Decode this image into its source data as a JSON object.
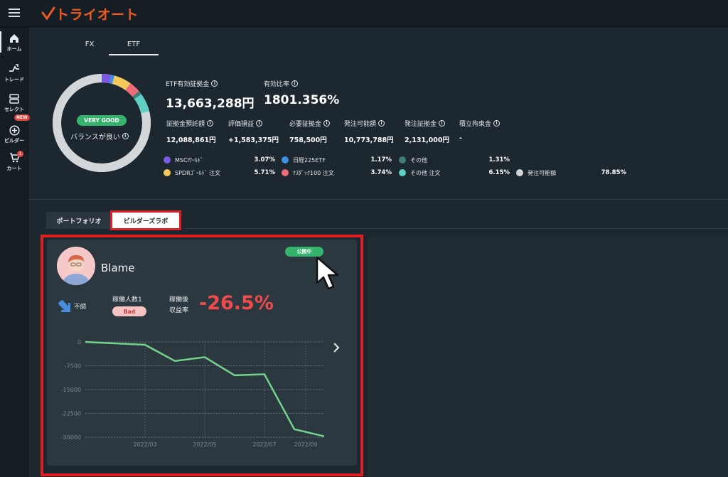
{
  "app": {
    "logo": "トライオート"
  },
  "sidebar": {
    "items": [
      {
        "label": "ホーム",
        "icon": "home-icon"
      },
      {
        "label": "トレード",
        "icon": "trade-icon"
      },
      {
        "label": "セレクト",
        "icon": "select-icon"
      },
      {
        "label": "ビルダー",
        "icon": "builder-icon",
        "badge": "NEW"
      },
      {
        "label": "カート",
        "icon": "cart-icon",
        "badge": "1"
      }
    ]
  },
  "tabs": [
    "FX",
    "ETF"
  ],
  "summary": {
    "status_badge": "VERY GOOD",
    "balance_text": "バランスが良い",
    "etf_margin_label": "ETF有効証拠金",
    "etf_margin_value": "13,663,288円",
    "ratio_label": "有効比率",
    "ratio_value": "1801.356%",
    "metrics": [
      {
        "label": "証拠金預託額",
        "value": "12,088,861円"
      },
      {
        "label": "評価損益",
        "value": "+1,583,375円"
      },
      {
        "label": "必要証拠金",
        "value": "758,500円"
      },
      {
        "label": "発注可能額",
        "value": "10,773,788円"
      },
      {
        "label": "発注証拠金",
        "value": "2,131,000円"
      },
      {
        "label": "積立拘束金",
        "value": "-"
      }
    ],
    "legend": [
      {
        "name": "MSCIﾜｰﾙﾄﾞ",
        "pct": "3.07%",
        "color": "#7b5be6"
      },
      {
        "name": "日経225ETF",
        "pct": "1.17%",
        "color": "#3e8fe0"
      },
      {
        "name": "その他",
        "pct": "1.31%",
        "color": "#3e7f76"
      },
      {
        "name": "SPDRｺﾞｰﾙﾄﾞ 注文",
        "pct": "5.71%",
        "color": "#f5c85a"
      },
      {
        "name": "ﾅｽﾀﾞｯｸ100 注文",
        "pct": "3.74%",
        "color": "#ef6b78"
      },
      {
        "name": "その他 注文",
        "pct": "6.15%",
        "color": "#5fd0c4"
      },
      {
        "name": "発注可能額",
        "pct": "78.85%",
        "color": "#d4d7da"
      }
    ]
  },
  "lower_tabs": [
    "ポートフォリオ",
    "ビルダーズラボ"
  ],
  "card": {
    "name": "Blame",
    "public_badge": "公開中",
    "trend_label": "不調",
    "workers_label": "稼働人数1",
    "bad_badge": "Bad",
    "profit_label_1": "稼働後",
    "profit_label_2": "収益率",
    "profit_value": "-26.5%"
  },
  "chart_data": {
    "type": "line",
    "yticks": [
      "0",
      "-7500",
      "-15000",
      "-22500",
      "-30000"
    ],
    "xticks": [
      "2022/03",
      "2022/05",
      "2022/07",
      "2022/09"
    ],
    "ylim": [
      -30000,
      0
    ],
    "series": [
      {
        "values": [
          0,
          -900,
          -6000,
          -4800,
          -10500,
          -10200,
          -27500,
          -29700
        ]
      }
    ],
    "line_color": "#74d38b",
    "grid": true
  }
}
